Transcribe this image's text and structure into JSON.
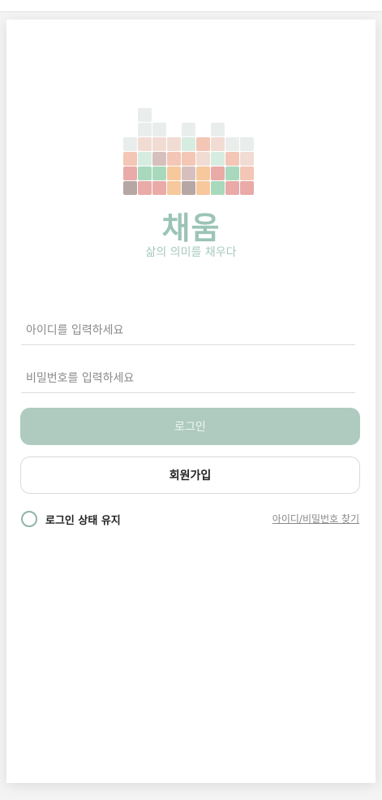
{
  "brand": {
    "name": "채움",
    "tagline": "삶의 의미를 채우다",
    "colors": {
      "accent": "#9bc4b6",
      "button": "#afcbbf",
      "logo_palette": [
        "#e9eeec",
        "#f1dcd4",
        "#d7ece0",
        "#d6c0bd",
        "#f3c6b5",
        "#a8d9bc",
        "#f6c89c",
        "#e9aaa8",
        "#b7a7a4"
      ]
    }
  },
  "login": {
    "id_placeholder": "아이디를 입력하세요",
    "password_placeholder": "비밀번호를 입력하세요",
    "login_label": "로그인",
    "signup_label": "회원가입",
    "remember_label": "로그인 상태 유지",
    "find_link": "아이디/비밀번호 찾기"
  }
}
